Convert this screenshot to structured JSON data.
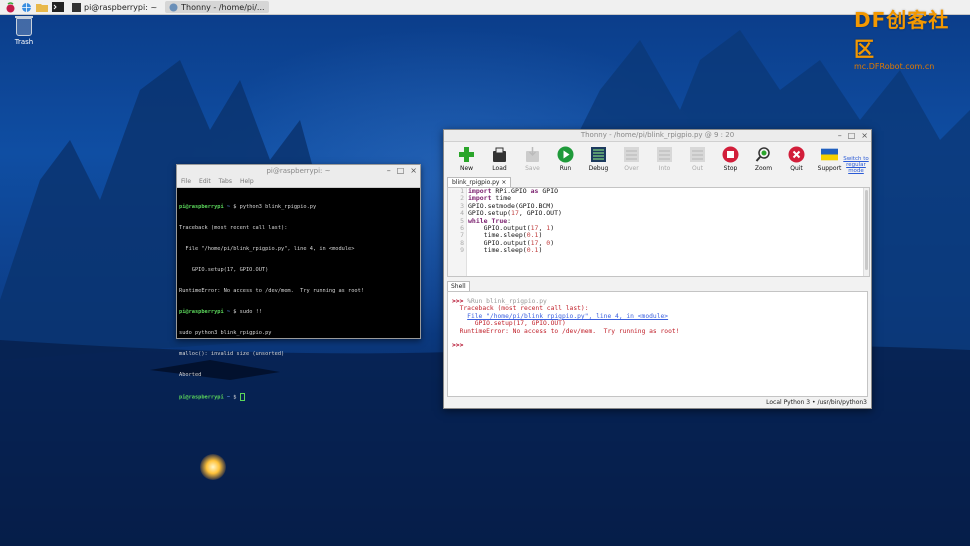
{
  "taskbar": {
    "launchers": [
      "raspberry-icon",
      "globe-icon",
      "folder-icon",
      "terminal-icon"
    ],
    "tasks": [
      {
        "label": "pi@raspberrypi: ~",
        "active": false
      },
      {
        "label": "Thonny - /home/pi/...",
        "active": true
      }
    ]
  },
  "brand": {
    "logo_text": "DF创客社区",
    "url": "mc.DFRobot.com.cn"
  },
  "desktop": {
    "trash_label": "Trash"
  },
  "terminal": {
    "title": "pi@raspberrypi: ~",
    "menu": [
      "File",
      "Edit",
      "Tabs",
      "Help"
    ],
    "lines": [
      {
        "prompt": "pi@raspberrypi",
        "path": "~",
        "cmd": "$ python3 blink_rpigpio.py"
      },
      {
        "text": "Traceback (most recent call last):"
      },
      {
        "text": "  File \"/home/pi/blink_rpigpio.py\", line 4, in <module>"
      },
      {
        "text": "    GPIO.setup(17, GPIO.OUT)"
      },
      {
        "text": "RuntimeError: No access to /dev/mem.  Try running as root!"
      },
      {
        "prompt": "pi@raspberrypi",
        "path": "~",
        "cmd": "$ sudo !!"
      },
      {
        "text": "sudo python3 blink_rpigpio.py"
      },
      {
        "text": "malloc(): invalid size (unsorted)"
      },
      {
        "text": "Aborted"
      },
      {
        "prompt": "pi@raspberrypi",
        "path": "~",
        "cmd": "$ "
      }
    ]
  },
  "thonny": {
    "title": "Thonny - /home/pi/blink_rpigpio.py @ 9 : 20",
    "toolbar": [
      {
        "label": "New",
        "icon": "new-icon",
        "enabled": true
      },
      {
        "label": "Load",
        "icon": "load-icon",
        "enabled": true
      },
      {
        "label": "Save",
        "icon": "save-icon",
        "enabled": false
      },
      {
        "label": "Run",
        "icon": "run-icon",
        "enabled": true
      },
      {
        "label": "Debug",
        "icon": "debug-icon",
        "enabled": true
      },
      {
        "label": "Over",
        "icon": "step-over-icon",
        "enabled": false
      },
      {
        "label": "Into",
        "icon": "step-into-icon",
        "enabled": false
      },
      {
        "label": "Out",
        "icon": "step-out-icon",
        "enabled": false
      },
      {
        "label": "Stop",
        "icon": "stop-icon",
        "enabled": true
      },
      {
        "label": "Zoom",
        "icon": "zoom-icon",
        "enabled": true
      },
      {
        "label": "Quit",
        "icon": "quit-icon",
        "enabled": true
      },
      {
        "label": "Support",
        "icon": "ukraine-flag-icon",
        "enabled": true
      }
    ],
    "switch_mode": "Switch to regular mode",
    "editor_tab": "blink_rpigpio.py ×",
    "code": [
      {
        "n": "1",
        "parts": [
          [
            "kw",
            "import"
          ],
          [
            "t",
            " RPi.GPIO "
          ],
          [
            "kw",
            "as"
          ],
          [
            "t",
            " GPIO"
          ]
        ]
      },
      {
        "n": "2",
        "parts": [
          [
            "kw",
            "import"
          ],
          [
            "t",
            " time"
          ]
        ]
      },
      {
        "n": "3",
        "parts": [
          [
            "t",
            "GPIO.setmode(GPIO.BCM)"
          ]
        ]
      },
      {
        "n": "4",
        "parts": [
          [
            "t",
            "GPIO.setup("
          ],
          [
            "num",
            "17"
          ],
          [
            "t",
            ", GPIO.OUT)"
          ]
        ]
      },
      {
        "n": "5",
        "parts": [
          [
            "kw",
            "while"
          ],
          [
            "t",
            " "
          ],
          [
            "kw",
            "True"
          ],
          [
            "t",
            ":"
          ]
        ]
      },
      {
        "n": "6",
        "parts": [
          [
            "t",
            "    GPIO.output("
          ],
          [
            "num",
            "17"
          ],
          [
            "t",
            ", "
          ],
          [
            "num",
            "1"
          ],
          [
            "t",
            ")"
          ]
        ]
      },
      {
        "n": "7",
        "parts": [
          [
            "t",
            "    time.sleep("
          ],
          [
            "num",
            "0.1"
          ],
          [
            "t",
            ")"
          ]
        ]
      },
      {
        "n": "8",
        "parts": [
          [
            "t",
            "    GPIO.output("
          ],
          [
            "num",
            "17"
          ],
          [
            "t",
            ", "
          ],
          [
            "num",
            "0"
          ],
          [
            "t",
            ")"
          ]
        ]
      },
      {
        "n": "9",
        "parts": [
          [
            "t",
            "    time.sleep("
          ],
          [
            "num",
            "0.1"
          ],
          [
            "t",
            ")"
          ]
        ]
      }
    ],
    "shell_tab": "Shell",
    "shell": {
      "run_cmd": "%Run blink_rpigpio.py",
      "traceback": "Traceback (most recent call last):",
      "file_link": "File \"/home/pi/blink_rpigpio.py\", line 4, in <module>",
      "code_line": "GPIO.setup(17, GPIO.OUT)",
      "error": "RuntimeError: No access to /dev/mem.  Try running as root!",
      "prompt": ">>>"
    },
    "status": "Local Python 3  •  /usr/bin/python3"
  }
}
